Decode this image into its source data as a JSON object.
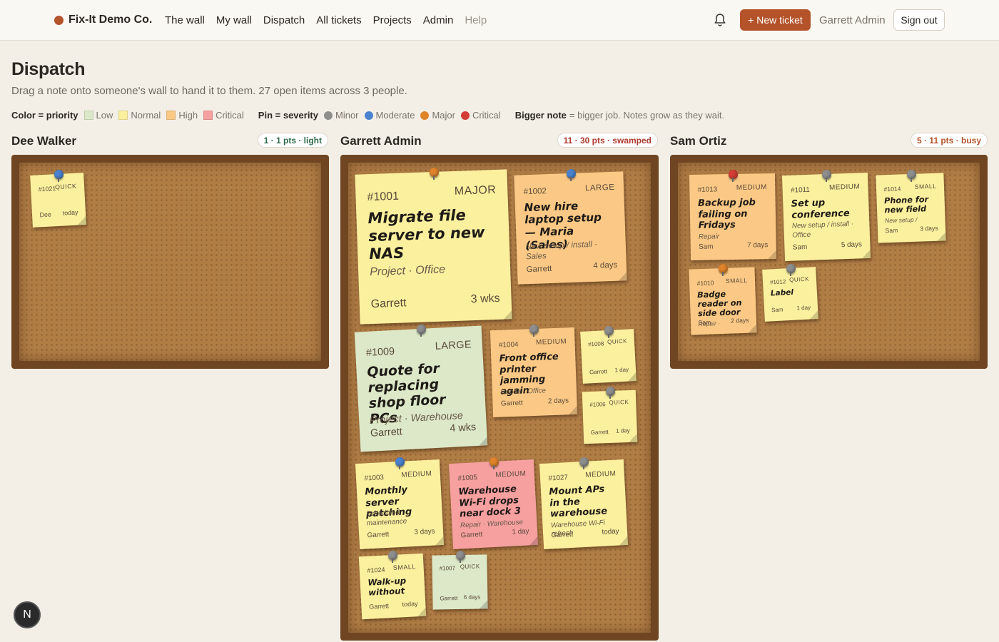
{
  "header": {
    "brand": "Fix-It Demo Co.",
    "brand_color": "#b4532a",
    "nav": [
      "The wall",
      "My wall",
      "Dispatch",
      "All tickets",
      "Projects",
      "Admin",
      "Help"
    ],
    "bell_icon": "bell-icon",
    "new_ticket": "+ New ticket",
    "user": "Garrett Admin",
    "sign_out": "Sign out"
  },
  "page": {
    "title": "Dispatch",
    "subtitle": "Drag a note onto someone's wall to hand it to them. 27 open items across 3 people."
  },
  "legend": {
    "color_label": "Color = priority",
    "colors": [
      {
        "label": "Low",
        "color": "#dce8c8"
      },
      {
        "label": "Normal",
        "color": "#fbf09e"
      },
      {
        "label": "High",
        "color": "#fbc985"
      },
      {
        "label": "Critical",
        "color": "#f6a0a0"
      }
    ],
    "pin_label": "Pin = severity",
    "pins": [
      {
        "label": "Minor",
        "color": "#8e8e8e"
      },
      {
        "label": "Moderate",
        "color": "#4a82cf"
      },
      {
        "label": "Major",
        "color": "#e0842a"
      },
      {
        "label": "Critical",
        "color": "#d33d35"
      }
    ],
    "size_label": "Bigger note",
    "size_text": "= bigger job. Notes grow as they wait."
  },
  "columns": [
    {
      "name": "Dee Walker",
      "badge": "1 · 1 pts · light",
      "badge_color": "#2e6b4a",
      "notes": [
        {
          "id": "#1021",
          "size": "QUICK",
          "title": "",
          "cat": "",
          "who": "Dee",
          "age": "today",
          "prio": "normal",
          "pin": "moderate"
        }
      ]
    },
    {
      "name": "Garrett Admin",
      "badge": "11 · 30 pts · swamped",
      "badge_color": "#b03a2e",
      "notes": [
        {
          "id": "#1001",
          "size": "MAJOR",
          "title": "Migrate file server to new NAS",
          "cat": "Project · Office",
          "who": "Garrett",
          "age": "3 wks",
          "prio": "normal",
          "pin": "major"
        },
        {
          "id": "#1002",
          "size": "LARGE",
          "title": "New hire laptop setup — Maria (Sales)",
          "cat": "New setup / install · Sales",
          "who": "Garrett",
          "age": "4 days",
          "prio": "high",
          "pin": "moderate"
        },
        {
          "id": "#1009",
          "size": "LARGE",
          "title": "Quote for replacing shop floor PCs",
          "cat": "Project · Warehouse",
          "who": "Garrett",
          "age": "4 wks",
          "prio": "low",
          "pin": "minor"
        },
        {
          "id": "#1004",
          "size": "MEDIUM",
          "title": "Front office printer jamming again",
          "cat": "Repair · Office",
          "who": "Garrett",
          "age": "2 days",
          "prio": "high",
          "pin": "minor"
        },
        {
          "id": "#1008",
          "size": "QUICK",
          "title": "",
          "cat": "",
          "who": "Garrett",
          "age": "1 day",
          "prio": "normal",
          "pin": "minor"
        },
        {
          "id": "#1006",
          "size": "QUICK",
          "title": "",
          "cat": "",
          "who": "Garrett",
          "age": "1 day",
          "prio": "normal",
          "pin": "minor"
        },
        {
          "id": "#1003",
          "size": "MEDIUM",
          "title": "Monthly server patching",
          "cat": "Scheduled maintenance",
          "who": "Garrett",
          "age": "3 days",
          "prio": "normal",
          "pin": "moderate"
        },
        {
          "id": "#1005",
          "size": "MEDIUM",
          "title": "Warehouse Wi-Fi drops near dock 3",
          "cat": "Repair · Warehouse",
          "who": "Garrett",
          "age": "1 day",
          "prio": "critical",
          "pin": "major"
        },
        {
          "id": "#1027",
          "size": "MEDIUM",
          "title": "Mount APs in the warehouse",
          "cat": "Warehouse Wi-Fi refresh",
          "who": "Garrett",
          "age": "today",
          "prio": "normal",
          "pin": "minor"
        },
        {
          "id": "#1024",
          "size": "SMALL",
          "title": "Walk-up without",
          "cat": "",
          "who": "Garrett",
          "age": "today",
          "prio": "normal",
          "pin": "minor"
        },
        {
          "id": "#1007",
          "size": "QUICK",
          "title": "",
          "cat": "",
          "who": "Garrett",
          "age": "6 days",
          "prio": "low",
          "pin": "minor"
        }
      ]
    },
    {
      "name": "Sam Ortiz",
      "badge": "5 · 11 pts · busy",
      "badge_color": "#b4532a",
      "notes": [
        {
          "id": "#1013",
          "size": "MEDIUM",
          "title": "Backup job failing on Fridays",
          "cat": "Repair",
          "who": "Sam",
          "age": "7 days",
          "prio": "high",
          "pin": "critical"
        },
        {
          "id": "#1011",
          "size": "MEDIUM",
          "title": "Set up conference",
          "cat": "New setup / install · Office",
          "who": "Sam",
          "age": "5 days",
          "prio": "normal",
          "pin": "minor"
        },
        {
          "id": "#1014",
          "size": "SMALL",
          "title": "Phone for new field",
          "cat": "New setup /",
          "who": "Sam",
          "age": "3 days",
          "prio": "normal",
          "pin": "minor"
        },
        {
          "id": "#1010",
          "size": "SMALL",
          "title": "Badge reader on side door",
          "cat": "Repair ·",
          "who": "Sam",
          "age": "2 days",
          "prio": "high",
          "pin": "major"
        },
        {
          "id": "#1012",
          "size": "QUICK",
          "title": "Label",
          "cat": "",
          "who": "Sam",
          "age": "1 day",
          "prio": "normal",
          "pin": "minor"
        }
      ]
    }
  ],
  "fab": "N"
}
